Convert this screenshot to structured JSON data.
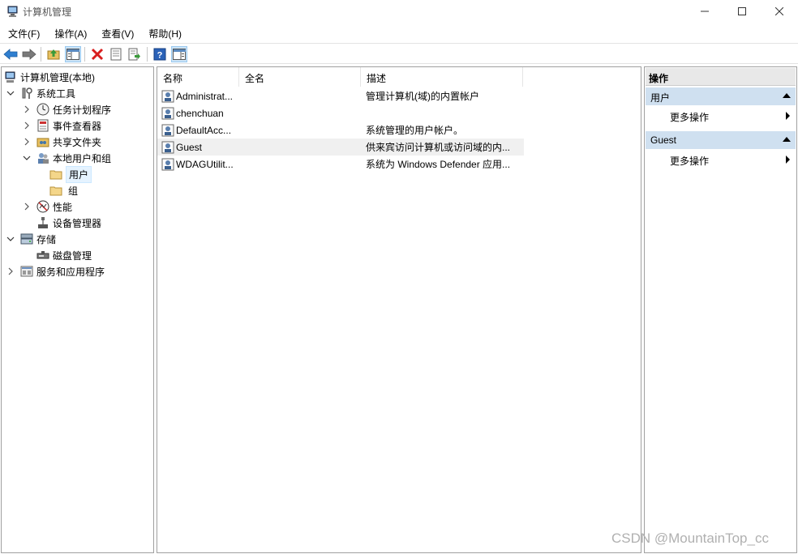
{
  "window": {
    "title": "计算机管理",
    "controls": {
      "minimize": "—",
      "maximize": "☐",
      "close": "✕"
    }
  },
  "menu": [
    "文件(F)",
    "操作(A)",
    "查看(V)",
    "帮助(H)"
  ],
  "toolbar": {
    "icons": [
      "back-arrow-icon",
      "forward-arrow-icon",
      "up-folder-icon",
      "show-hide-tree-icon",
      "delete-icon",
      "properties-icon",
      "export-list-icon",
      "help-icon",
      "action-pane-icon"
    ]
  },
  "tree": {
    "root": "计算机管理(本地)",
    "system_tools": "系统工具",
    "task_scheduler": "任务计划程序",
    "event_viewer": "事件查看器",
    "shared_folders": "共享文件夹",
    "local_users_groups": "本地用户和组",
    "users": "用户",
    "groups": "组",
    "performance": "性能",
    "device_manager": "设备管理器",
    "storage": "存储",
    "disk_management": "磁盘管理",
    "services_apps": "服务和应用程序"
  },
  "list": {
    "columns": {
      "name": "名称",
      "fullname": "全名",
      "description": "描述"
    },
    "rows": [
      {
        "name": "Administrat...",
        "fullname": "",
        "description": "管理计算机(域)的内置帐户"
      },
      {
        "name": "chenchuan",
        "fullname": "",
        "description": ""
      },
      {
        "name": "DefaultAcc...",
        "fullname": "",
        "description": "系统管理的用户帐户。"
      },
      {
        "name": "Guest",
        "fullname": "",
        "description": "供来宾访问计算机或访问域的内..."
      },
      {
        "name": "WDAGUtilit...",
        "fullname": "",
        "description": "系统为 Windows Defender 应用..."
      }
    ]
  },
  "actions": {
    "title": "操作",
    "section1": "用户",
    "section1_more": "更多操作",
    "section2": "Guest",
    "section2_more": "更多操作"
  },
  "watermark": "CSDN @MountainTop_cc",
  "colors": {
    "selection": "#e5f3ff",
    "section_header": "#cfe0f0",
    "row_highlight": "#f0f0f0"
  }
}
